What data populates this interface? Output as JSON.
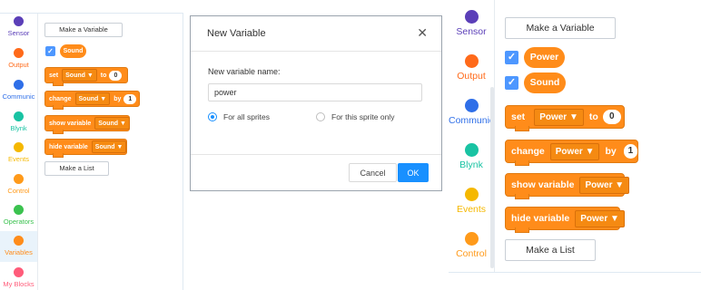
{
  "colors": {
    "orange": "#ff8c1a",
    "blue": "#4d97ff",
    "ok_blue": "#1890ff"
  },
  "left": {
    "categories": [
      {
        "label": "Sensor",
        "color": "#5b3fb8",
        "dot": "yes"
      },
      {
        "label": "Output",
        "color": "#ff6a1a"
      },
      {
        "label": "Communic",
        "color": "#2f6fe8"
      },
      {
        "label": "Blynk",
        "color": "#19c3a3"
      },
      {
        "label": "Events",
        "color": "#f5b800"
      },
      {
        "label": "Control",
        "color": "#ff9a1a"
      },
      {
        "label": "Operators",
        "color": "#3bc24f"
      },
      {
        "label": "Variables",
        "color": "#ff8c1a"
      },
      {
        "label": "My Blocks",
        "color": "#ff5c7a"
      }
    ],
    "make_variable": "Make a Variable",
    "checkmark": "✓",
    "variable_sound": "Sound",
    "block_set": {
      "word": "set",
      "var": "Sound",
      "to": "to",
      "value": "0"
    },
    "block_change": {
      "word": "change",
      "var": "Sound",
      "by": "by",
      "value": "1"
    },
    "block_show": {
      "word": "show variable",
      "var": "Sound"
    },
    "block_hide": {
      "word": "hide variable",
      "var": "Sound"
    },
    "make_list": "Make a List"
  },
  "dialog": {
    "title": "New Variable",
    "close": "✕",
    "field_label": "New variable name:",
    "field_value": "power",
    "radio_all": "For all sprites",
    "radio_this": "For this sprite only",
    "cancel": "Cancel",
    "ok": "OK"
  },
  "right": {
    "categories": [
      {
        "label": "Sensor",
        "color": "#5b3fb8"
      },
      {
        "label": "Output",
        "color": "#ff6a1a"
      },
      {
        "label": "Communic",
        "color": "#2f6fe8"
      },
      {
        "label": "Blynk",
        "color": "#19c3a3"
      },
      {
        "label": "Events",
        "color": "#f5b800"
      },
      {
        "label": "Control",
        "color": "#ff9a1a"
      }
    ],
    "make_variable": "Make a Variable",
    "checkmark": "✓",
    "variable_power": "Power",
    "variable_sound": "Sound",
    "block_set": {
      "word": "set",
      "var": "Power",
      "to": "to",
      "value": "0"
    },
    "block_change": {
      "word": "change",
      "var": "Power",
      "by": "by",
      "value": "1"
    },
    "block_show": {
      "word": "show variable",
      "var": "Power"
    },
    "block_hide": {
      "word": "hide variable",
      "var": "Power"
    },
    "make_list": "Make a List"
  },
  "dropdown_arrow": "▼"
}
